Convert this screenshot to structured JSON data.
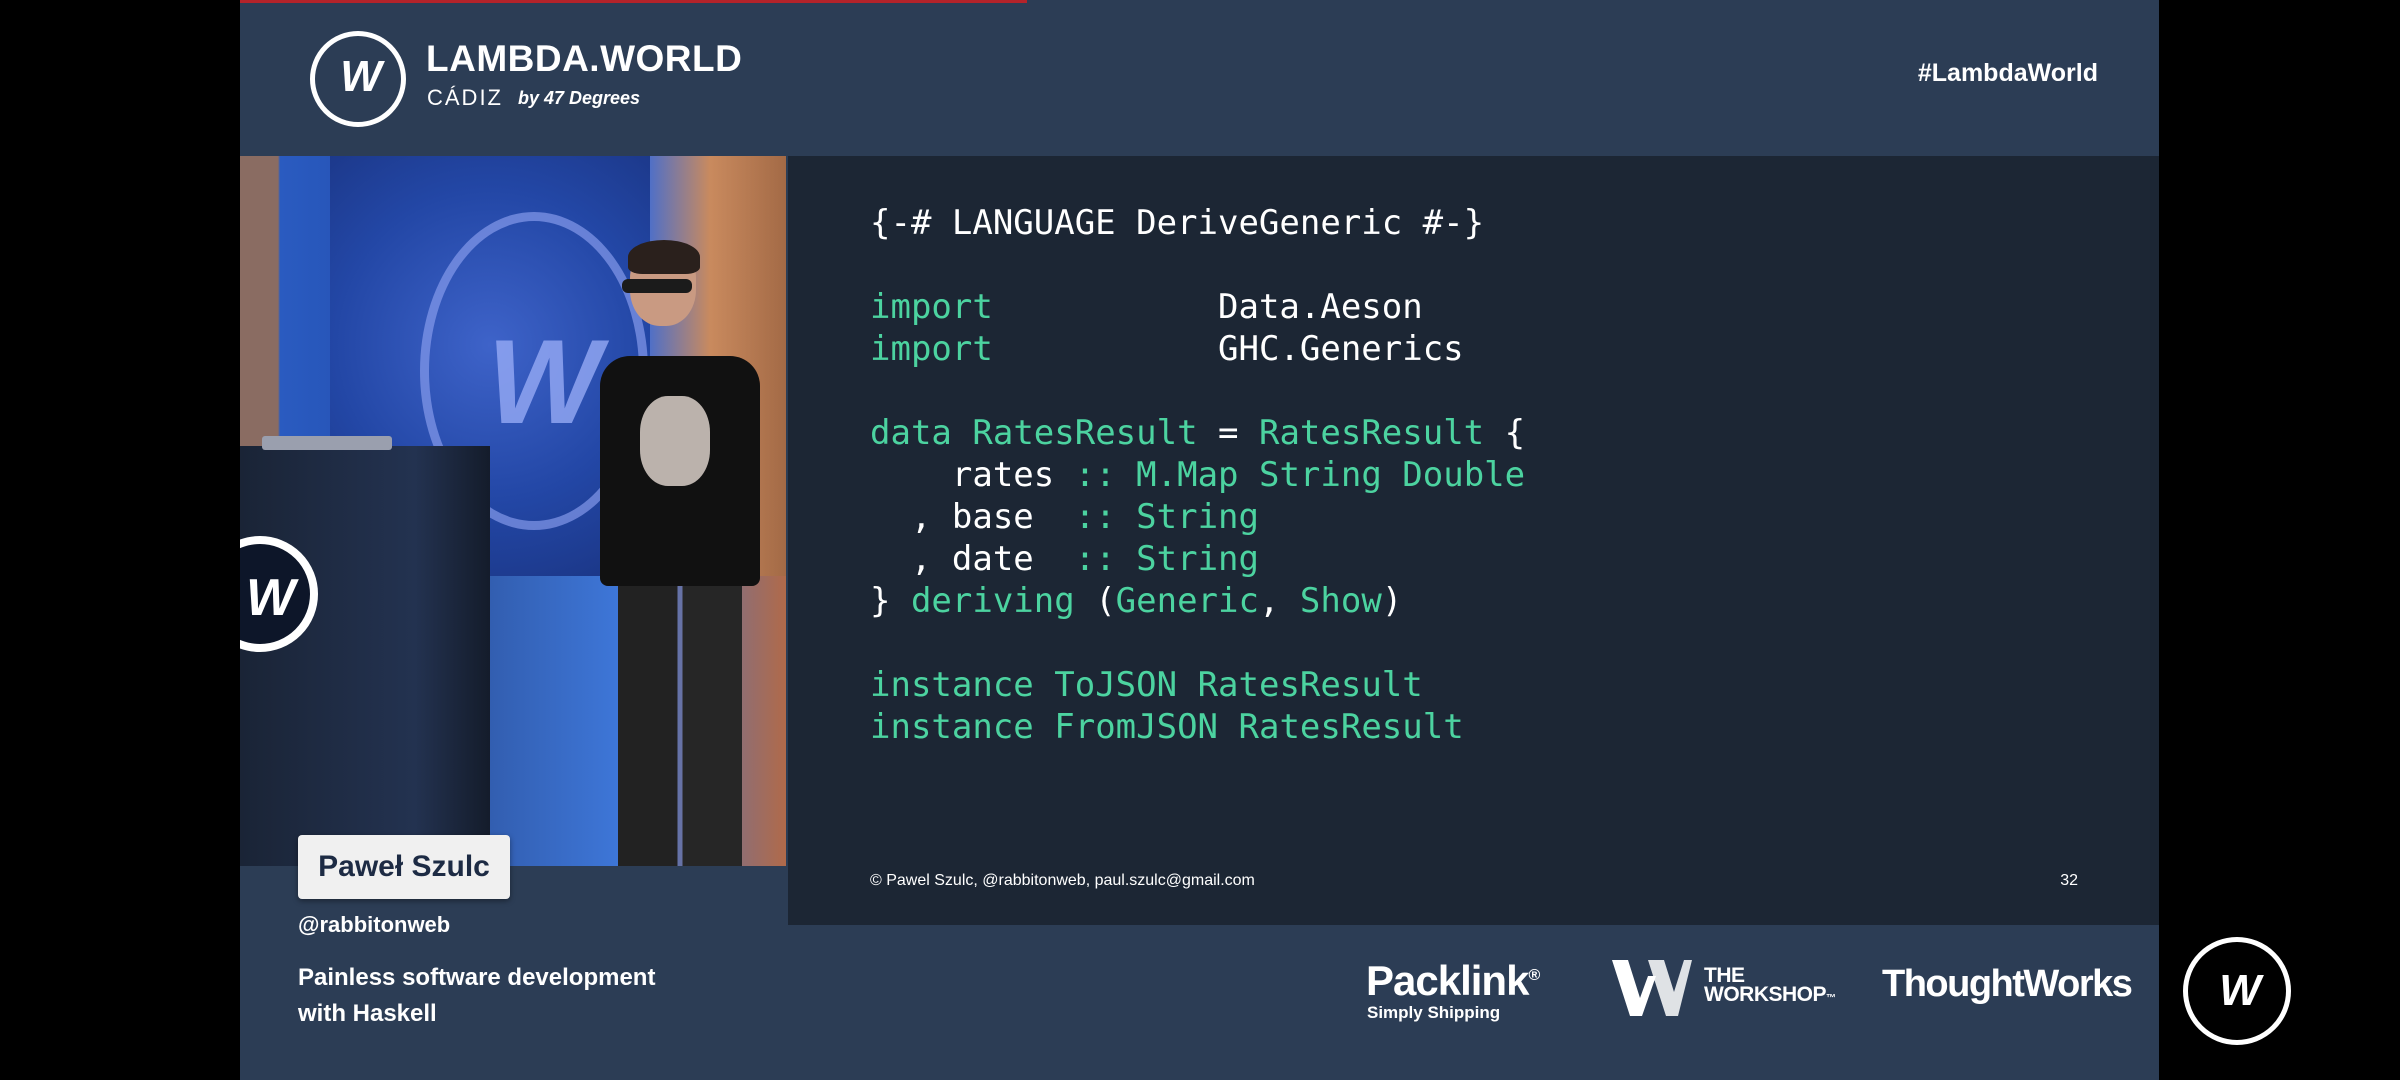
{
  "header": {
    "brand_title": "LAMBDA.WORLD",
    "brand_city": "CÁDIZ",
    "brand_by": "by 47 Degrees",
    "hashtag": "#LambdaWorld",
    "logo_letter": "W"
  },
  "slide": {
    "code": {
      "line1": "{-# LANGUAGE DeriveGeneric #-}",
      "import_kw": "import",
      "import1": "Data.Aeson",
      "import2": "GHC.Generics",
      "data_kw": "data",
      "type_name": "RatesResult",
      "eq": " = ",
      "ctor": "RatesResult",
      "brace_open": " {",
      "field1": "rates",
      "field1_type": "M.Map String Double",
      "field2": "base",
      "field2_type": "String",
      "field3": "date",
      "field3_type": "String",
      "deriving_kw": "deriving",
      "deriving_classes": [
        "Generic",
        "Show"
      ],
      "instance_kw": "instance",
      "instance1_class": "ToJSON",
      "instance2_class": "FromJSON"
    },
    "footer": "© Pawel Szulc, @rabbitonweb, paul.szulc@gmail.com",
    "page_number": "32"
  },
  "speaker": {
    "name": "Paweł Szulc",
    "handle": "@rabbitonweb",
    "talk_title": "Painless software development with Haskell"
  },
  "sponsors": {
    "packlink": "Packlink",
    "packlink_reg": "®",
    "packlink_tagline": "Simply Shipping",
    "workshop_line1": "THE",
    "workshop_line2": "WORKSHOP",
    "workshop_tm": "™",
    "thoughtworks": "ThoughtWorks"
  },
  "colors": {
    "frame_bg": "#2c3d55",
    "slide_bg": "#1c2634",
    "code_keyword": "#4cd3a0",
    "progress": "#b4232a"
  },
  "video": {
    "progress_fraction": 0.41
  }
}
